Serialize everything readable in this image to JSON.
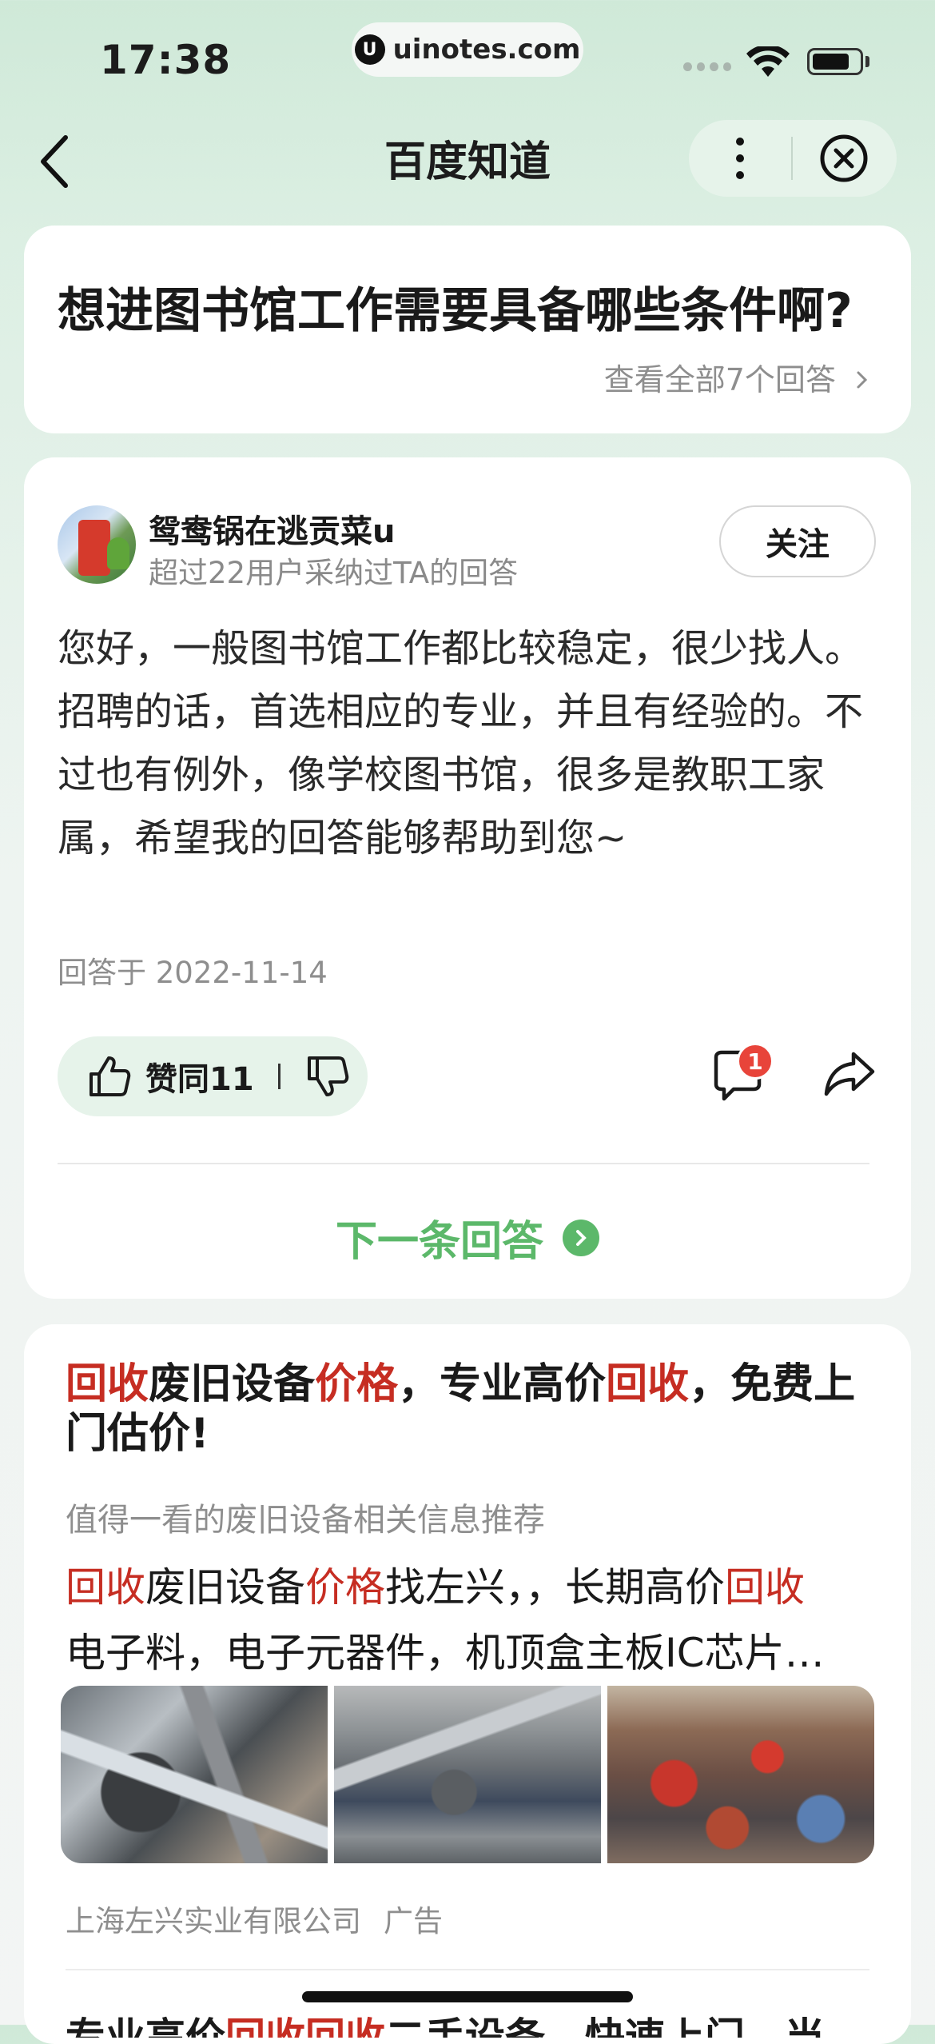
{
  "status": {
    "time": "17:38",
    "url": "uinotes.com"
  },
  "nav": {
    "title": "百度知道"
  },
  "question": {
    "title": "想进图书馆工作需要具备哪些条件啊?",
    "all_answers": "查看全部7个回答"
  },
  "answer": {
    "user": "鸳鸯锅在逃贡菜u",
    "user_sub": "超过22用户采纳过TA的回答",
    "follow": "关注",
    "text": "您好，一般图书馆工作都比较稳定，很少找人。招聘的话，首选相应的专业，并且有经验的。不过也有例外，像学校图书馆，很多是教职工家属，希望我的回答能够帮助到您~",
    "date": "回答于 2022-11-14",
    "likes": "赞同11",
    "comment_badge": "1",
    "next": "下一条回答"
  },
  "ad": {
    "title_parts": [
      "回收",
      "废旧设备",
      "价格",
      "，专业高价",
      "回收",
      "，免费上门估价!"
    ],
    "sub": "值得一看的废旧设备相关信息推荐",
    "desc1_parts": [
      "回收",
      "废旧设备",
      "价格",
      "找左兴，，长期高价",
      "回收"
    ],
    "desc2": "电子料，电子元器件，机顶盒主板IC芯片…",
    "source": "上海左兴实业有限公司",
    "tag": "广告",
    "next_parts": [
      "专业高价",
      "回收回收",
      "二手设备，快速上门，当"
    ]
  },
  "colors": {
    "highlight": "#c62d22",
    "accent_green": "#5cb86a"
  }
}
